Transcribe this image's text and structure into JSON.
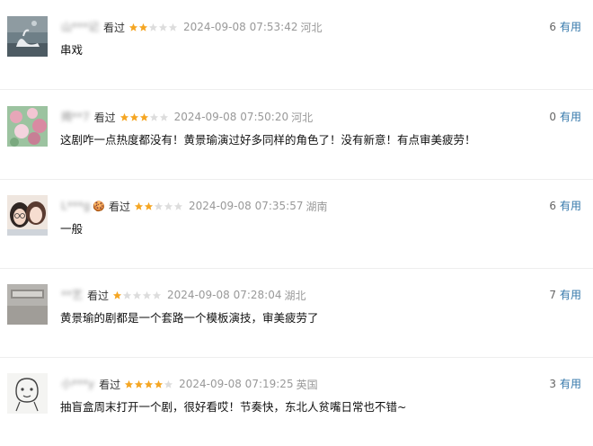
{
  "comments": [
    {
      "user": "山***记",
      "visited_label": "看过",
      "rating": 2,
      "time": "2024-09-08 07:53:42",
      "location": "河北",
      "text": "串戏",
      "useful_count": "6",
      "useful_label": "有用",
      "avatar_icon": "avatar-swan-photo"
    },
    {
      "user": "揭**7",
      "visited_label": "看过",
      "rating": 3,
      "time": "2024-09-08 07:50:20",
      "location": "河北",
      "text": "这剧咋一点热度都没有！黄景瑜演过好多同样的角色了！没有新意！有点审美疲劳！",
      "useful_count": "0",
      "useful_label": "有用",
      "avatar_icon": "avatar-flowers-photo"
    },
    {
      "user": "L***g",
      "emoji": "🍪",
      "visited_label": "看过",
      "rating": 2,
      "time": "2024-09-08 07:35:57",
      "location": "湖南",
      "text": "一般",
      "useful_count": "6",
      "useful_label": "有用",
      "avatar_icon": "avatar-two-girls-photo"
    },
    {
      "user": "**艺",
      "visited_label": "看过",
      "rating": 1,
      "time": "2024-09-08 07:28:04",
      "location": "湖北",
      "text": "黄景瑜的剧都是一个套路一个模板演技，审美疲劳了",
      "useful_count": "7",
      "useful_label": "有用",
      "avatar_icon": "avatar-grey-photo"
    },
    {
      "user": "小***y",
      "visited_label": "看过",
      "rating": 4,
      "time": "2024-09-08 07:19:25",
      "location": "英国",
      "text": "抽盲盒周末打开一个剧，很好看哎！节奏快，东北人贫嘴日常也不错~",
      "useful_count": "3",
      "useful_label": "有用",
      "avatar_icon": "avatar-doodle-drawing"
    }
  ],
  "colors": {
    "star_filled": "#f5a623",
    "star_empty": "#dddddd",
    "useful_link": "#3377aa",
    "meta_gray": "#999999"
  }
}
